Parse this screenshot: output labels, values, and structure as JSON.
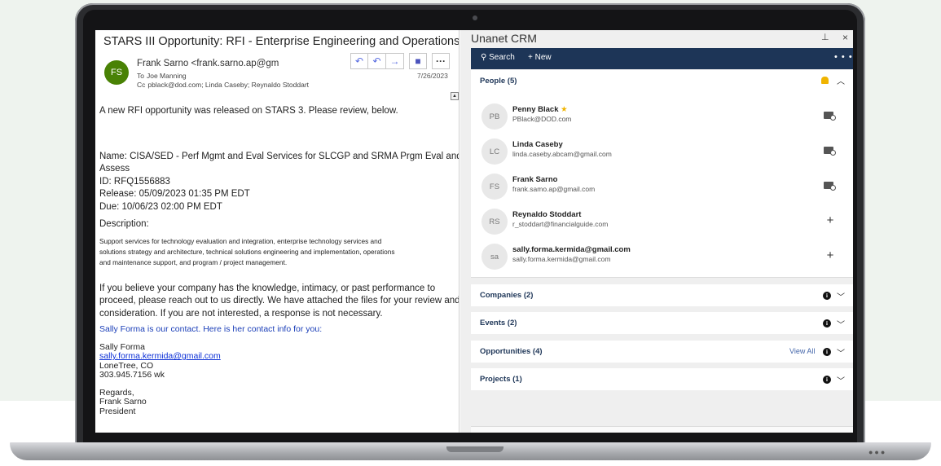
{
  "crm": {
    "title": "Unanet CRM",
    "pin": "⊥",
    "close": "×",
    "toolbar": {
      "search": "Search",
      "new": "New",
      "more": "• • •"
    },
    "people": {
      "title": "People (5)",
      "items": [
        {
          "initials": "PB",
          "name": "Penny Black",
          "email": "PBlack@DOD.com",
          "action": "mail"
        },
        {
          "initials": "LC",
          "name": "Linda Caseby",
          "email": "linda.caseby.abcam@gmail.com",
          "action": "mail"
        },
        {
          "initials": "FS",
          "name": "Frank Sarno",
          "email": "frank.samo.ap@gmail.com",
          "action": "mail"
        },
        {
          "initials": "RS",
          "name": "Reynaldo Stoddart",
          "email": "r_stoddart@financialguide.com",
          "action": "+"
        },
        {
          "initials": "sa",
          "name": "sally.forma.kermida@gmail.com",
          "email": "sally.forma.kermida@gmail.com",
          "action": "+"
        }
      ]
    },
    "sections": [
      {
        "title": "Companies (2)",
        "view_all": ""
      },
      {
        "title": "Events (2)",
        "view_all": ""
      },
      {
        "title": "Opportunities (4)",
        "view_all": "View All"
      },
      {
        "title": "Projects (1)",
        "view_all": ""
      }
    ]
  },
  "email": {
    "subject": "STARS III Opportunity: RFI - Enterprise Engineering and Operations Services",
    "avatar": "FS",
    "from": "Frank Sarno <frank.sarno.ap@gm",
    "to_label": "To",
    "to": "Joe Manning",
    "cc_label": "Cc",
    "cc": "pblack@dod.com; Linda Caseby; Reynaldo Stoddart",
    "date": "7/26/2023",
    "body": {
      "intro": "A new RFI opportunity was released on STARS 3. Please review, below.",
      "name1": "Name: CISA/SED - Perf Mgmt and Eval Services for SLCGP and SRMA Prgm Eval and",
      "name2": "Assess",
      "id": "ID: RFQ1556883",
      "release": "Release: 05/09/2023 01:35 PM EDT",
      "due": "Due: 10/06/23 02:00 PM EDT",
      "desc_label": "Description:",
      "desc1": "Support services for technology evaluation and integration, enterprise technology services and",
      "desc2": "solutions strategy and architecture, technical solutions engineering and implementation, operations",
      "desc3": "and maintenance support, and program / project management.",
      "p1": "If you believe your company has the knowledge, intimacy, or past performance to",
      "p2": "proceed, please reach out to us directly. We have attached the files for your review and",
      "p3": "consideration. If you are not interested, a response is not necessary.",
      "contact_line": "Sally Forma is our contact.   Here is her contact info for you:",
      "sig_name": "Sally Forma",
      "sig_email": "sally.forma.kermida@gmail.com",
      "sig_city": "LoneTree, CO",
      "sig_phone": "303.945.7156 wk",
      "regards": "Regards,",
      "regards_name": "Frank Sarno",
      "regards_title": "President"
    }
  },
  "colors": {
    "crm_toolbar": "#1d3557",
    "avatar": "#498205",
    "link": "#0b2fd6",
    "star": "#f0b400"
  }
}
